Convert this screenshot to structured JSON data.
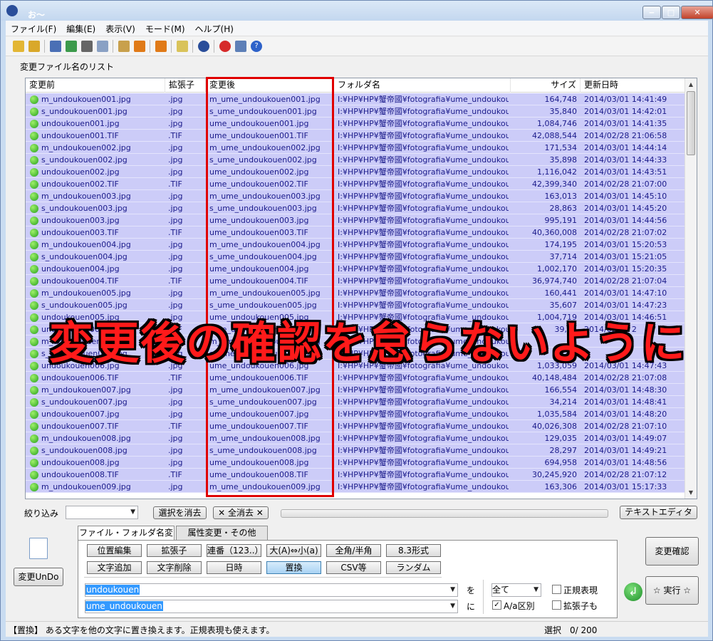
{
  "window": {
    "title": "お〜瑠璃ね〜む",
    "min": "‒",
    "max": "□",
    "close": "✕"
  },
  "menu": [
    "ファイル(F)",
    "編集(E)",
    "表示(V)",
    "モード(M)",
    "ヘルプ(H)"
  ],
  "list_label": "変更ファイル名のリスト",
  "columns": {
    "before": "変更前",
    "ext": "拡張子",
    "after": "変更後",
    "folder": "フォルダ名",
    "size": "サイズ",
    "date": "更新日時"
  },
  "rows": [
    {
      "before": "m_undoukouen001.jpg",
      "ext": ".jpg",
      "after": "m_ume_undoukouen001.jpg",
      "folder": "I:¥HP¥HP¥蟹帝國¥fotografia¥ume_undoukoue...",
      "size": "164,748",
      "date": "2014/03/01 14:41:49"
    },
    {
      "before": "s_undoukouen001.jpg",
      "ext": ".jpg",
      "after": "s_ume_undoukouen001.jpg",
      "folder": "I:¥HP¥HP¥蟹帝國¥fotografia¥ume_undoukoue...",
      "size": "35,840",
      "date": "2014/03/01 14:42:01"
    },
    {
      "before": "undoukouen001.jpg",
      "ext": ".jpg",
      "after": "ume_undoukouen001.jpg",
      "folder": "I:¥HP¥HP¥蟹帝國¥fotografia¥ume_undoukoue...",
      "size": "1,084,746",
      "date": "2014/03/01 14:41:35"
    },
    {
      "before": "undoukouen001.TIF",
      "ext": ".TIF",
      "after": "ume_undoukouen001.TIF",
      "folder": "I:¥HP¥HP¥蟹帝國¥fotografia¥ume_undoukoue...",
      "size": "42,088,544",
      "date": "2014/02/28 21:06:58"
    },
    {
      "before": "m_undoukouen002.jpg",
      "ext": ".jpg",
      "after": "m_ume_undoukouen002.jpg",
      "folder": "I:¥HP¥HP¥蟹帝國¥fotografia¥ume_undoukoue...",
      "size": "171,534",
      "date": "2014/03/01 14:44:14"
    },
    {
      "before": "s_undoukouen002.jpg",
      "ext": ".jpg",
      "after": "s_ume_undoukouen002.jpg",
      "folder": "I:¥HP¥HP¥蟹帝國¥fotografia¥ume_undoukoue...",
      "size": "35,898",
      "date": "2014/03/01 14:44:33"
    },
    {
      "before": "undoukouen002.jpg",
      "ext": ".jpg",
      "after": "ume_undoukouen002.jpg",
      "folder": "I:¥HP¥HP¥蟹帝國¥fotografia¥ume_undoukoue...",
      "size": "1,116,042",
      "date": "2014/03/01 14:43:51"
    },
    {
      "before": "undoukouen002.TIF",
      "ext": ".TIF",
      "after": "ume_undoukouen002.TIF",
      "folder": "I:¥HP¥HP¥蟹帝國¥fotografia¥ume_undoukoue...",
      "size": "42,399,340",
      "date": "2014/02/28 21:07:00"
    },
    {
      "before": "m_undoukouen003.jpg",
      "ext": ".jpg",
      "after": "m_ume_undoukouen003.jpg",
      "folder": "I:¥HP¥HP¥蟹帝國¥fotografia¥ume_undoukoue...",
      "size": "163,013",
      "date": "2014/03/01 14:45:10"
    },
    {
      "before": "s_undoukouen003.jpg",
      "ext": ".jpg",
      "after": "s_ume_undoukouen003.jpg",
      "folder": "I:¥HP¥HP¥蟹帝國¥fotografia¥ume_undoukoue...",
      "size": "28,863",
      "date": "2014/03/01 14:45:20"
    },
    {
      "before": "undoukouen003.jpg",
      "ext": ".jpg",
      "after": "ume_undoukouen003.jpg",
      "folder": "I:¥HP¥HP¥蟹帝國¥fotografia¥ume_undoukoue...",
      "size": "995,191",
      "date": "2014/03/01 14:44:56"
    },
    {
      "before": "undoukouen003.TIF",
      "ext": ".TIF",
      "after": "ume_undoukouen003.TIF",
      "folder": "I:¥HP¥HP¥蟹帝國¥fotografia¥ume_undoukoue...",
      "size": "40,360,008",
      "date": "2014/02/28 21:07:02"
    },
    {
      "before": "m_undoukouen004.jpg",
      "ext": ".jpg",
      "after": "m_ume_undoukouen004.jpg",
      "folder": "I:¥HP¥HP¥蟹帝國¥fotografia¥ume_undoukoue...",
      "size": "174,195",
      "date": "2014/03/01 15:20:53"
    },
    {
      "before": "s_undoukouen004.jpg",
      "ext": ".jpg",
      "after": "s_ume_undoukouen004.jpg",
      "folder": "I:¥HP¥HP¥蟹帝國¥fotografia¥ume_undoukoue...",
      "size": "37,714",
      "date": "2014/03/01 15:21:05"
    },
    {
      "before": "undoukouen004.jpg",
      "ext": ".jpg",
      "after": "ume_undoukouen004.jpg",
      "folder": "I:¥HP¥HP¥蟹帝國¥fotografia¥ume_undoukoue...",
      "size": "1,002,170",
      "date": "2014/03/01 15:20:35"
    },
    {
      "before": "undoukouen004.TIF",
      "ext": ".TIF",
      "after": "ume_undoukouen004.TIF",
      "folder": "I:¥HP¥HP¥蟹帝國¥fotografia¥ume_undoukoue...",
      "size": "36,974,740",
      "date": "2014/02/28 21:07:04"
    },
    {
      "before": "m_undoukouen005.jpg",
      "ext": ".jpg",
      "after": "m_ume_undoukouen005.jpg",
      "folder": "I:¥HP¥HP¥蟹帝國¥fotografia¥ume_undoukoue...",
      "size": "160,441",
      "date": "2014/03/01 14:47:10"
    },
    {
      "before": "s_undoukouen005.jpg",
      "ext": ".jpg",
      "after": "s_ume_undoukouen005.jpg",
      "folder": "I:¥HP¥HP¥蟹帝國¥fotografia¥ume_undoukoue...",
      "size": "35,607",
      "date": "2014/03/01 14:47:23"
    },
    {
      "before": "undoukouen005.jpg",
      "ext": ".jpg",
      "after": "ume_undoukouen005.jpg",
      "folder": "I:¥HP¥HP¥蟹帝國¥fotografia¥ume_undoukoue...",
      "size": "1,004,719",
      "date": "2014/03/01 14:46:51"
    },
    {
      "before": "undoukouen005.TIF",
      "ext": ".TIF",
      "after": "ume_undoukouen005.TIF",
      "folder": "I:¥HP¥HP¥蟹帝國¥fotografia¥ume_undoukoue...",
      "size": "39,66",
      "date": "2014/02/28 2"
    },
    {
      "before": "m_undoukouen006.jpg",
      "ext": ".jpg",
      "after": "m_ume_undoukouen006.jpg",
      "folder": "I:¥HP¥HP¥蟹帝國¥fotografia¥ume_undoukoue...",
      "size": "",
      "date": ""
    },
    {
      "before": "s_undoukouen006.jpg",
      "ext": ".jpg",
      "after": "s_ume_undoukouen006.jpg",
      "folder": "I:¥HP¥HP¥蟹帝國¥fotografia¥ume_undoukoue...",
      "size": "",
      "date": ""
    },
    {
      "before": "undoukouen006.jpg",
      "ext": ".jpg",
      "after": "ume_undoukouen006.jpg",
      "folder": "I:¥HP¥HP¥蟹帝國¥fotografia¥ume_undoukoue...",
      "size": "1,033,059",
      "date": "2014/03/01 14:47:43"
    },
    {
      "before": "undoukouen006.TIF",
      "ext": ".TIF",
      "after": "ume_undoukouen006.TIF",
      "folder": "I:¥HP¥HP¥蟹帝國¥fotografia¥ume_undoukoue...",
      "size": "40,148,484",
      "date": "2014/02/28 21:07:08"
    },
    {
      "before": "m_undoukouen007.jpg",
      "ext": ".jpg",
      "after": "m_ume_undoukouen007.jpg",
      "folder": "I:¥HP¥HP¥蟹帝國¥fotografia¥ume_undoukoue...",
      "size": "166,554",
      "date": "2014/03/01 14:48:30"
    },
    {
      "before": "s_undoukouen007.jpg",
      "ext": ".jpg",
      "after": "s_ume_undoukouen007.jpg",
      "folder": "I:¥HP¥HP¥蟹帝國¥fotografia¥ume_undoukoue...",
      "size": "34,214",
      "date": "2014/03/01 14:48:41"
    },
    {
      "before": "undoukouen007.jpg",
      "ext": ".jpg",
      "after": "ume_undoukouen007.jpg",
      "folder": "I:¥HP¥HP¥蟹帝國¥fotografia¥ume_undoukoue...",
      "size": "1,035,584",
      "date": "2014/03/01 14:48:20"
    },
    {
      "before": "undoukouen007.TIF",
      "ext": ".TIF",
      "after": "ume_undoukouen007.TIF",
      "folder": "I:¥HP¥HP¥蟹帝國¥fotografia¥ume_undoukoue...",
      "size": "40,026,308",
      "date": "2014/02/28 21:07:10"
    },
    {
      "before": "m_undoukouen008.jpg",
      "ext": ".jpg",
      "after": "m_ume_undoukouen008.jpg",
      "folder": "I:¥HP¥HP¥蟹帝國¥fotografia¥ume_undoukoue...",
      "size": "129,035",
      "date": "2014/03/01 14:49:07"
    },
    {
      "before": "s_undoukouen008.jpg",
      "ext": ".jpg",
      "after": "s_ume_undoukouen008.jpg",
      "folder": "I:¥HP¥HP¥蟹帝國¥fotografia¥ume_undoukoue...",
      "size": "28,297",
      "date": "2014/03/01 14:49:21"
    },
    {
      "before": "undoukouen008.jpg",
      "ext": ".jpg",
      "after": "ume_undoukouen008.jpg",
      "folder": "I:¥HP¥HP¥蟹帝國¥fotografia¥ume_undoukoue...",
      "size": "694,958",
      "date": "2014/03/01 14:48:56"
    },
    {
      "before": "undoukouen008.TIF",
      "ext": ".TIF",
      "after": "ume_undoukouen008.TIF",
      "folder": "I:¥HP¥HP¥蟹帝國¥fotografia¥ume_undoukoue...",
      "size": "30,245,920",
      "date": "2014/02/28 21:07:12"
    },
    {
      "before": "m_undoukouen009.jpg",
      "ext": ".jpg",
      "after": "m_ume_undoukouen009.jpg",
      "folder": "I:¥HP¥HP¥蟹帝國¥fotografia¥ume_undoukoue...",
      "size": "163,306",
      "date": "2014/03/01 15:17:33"
    }
  ],
  "overlay_text": "変更後の確認を怠らないように",
  "filter": {
    "label": "絞り込み",
    "value": "",
    "clear_selection": "選択を消去",
    "clear_all": "✕ 全消去 ✕",
    "text_editor": "テキストエディタ"
  },
  "tabs": [
    "ファイル・フォルダ名変更",
    "属性変更・その他"
  ],
  "undo": {
    "label": "変更UnDo"
  },
  "ops": [
    [
      "位置編集",
      "拡張子",
      "連番（123..）",
      "大(A)⇔小(a)",
      "全角/半角",
      "8.3形式"
    ],
    [
      "文字追加",
      "文字削除",
      "日時",
      "置換",
      "CSV等",
      "ランダム"
    ]
  ],
  "selected_op": "置換",
  "replace": {
    "from": "undoukouen",
    "to": "ume_undoukouen",
    "wo": "を",
    "ni": "に",
    "scope": "全て",
    "regex": "正規表現",
    "case": "A/a区別",
    "ext_too": "拡張子も",
    "case_checked": "✓"
  },
  "actions": {
    "confirm": "変更確認",
    "run": "☆ 実行 ☆"
  },
  "status": {
    "message": "【置換】 ある文字を他の文字に置き換えます。正規表現も使えます。",
    "selection": "選択　0/ 200"
  },
  "colors": {
    "row": "#ccccf8",
    "accent": "#e00000"
  }
}
